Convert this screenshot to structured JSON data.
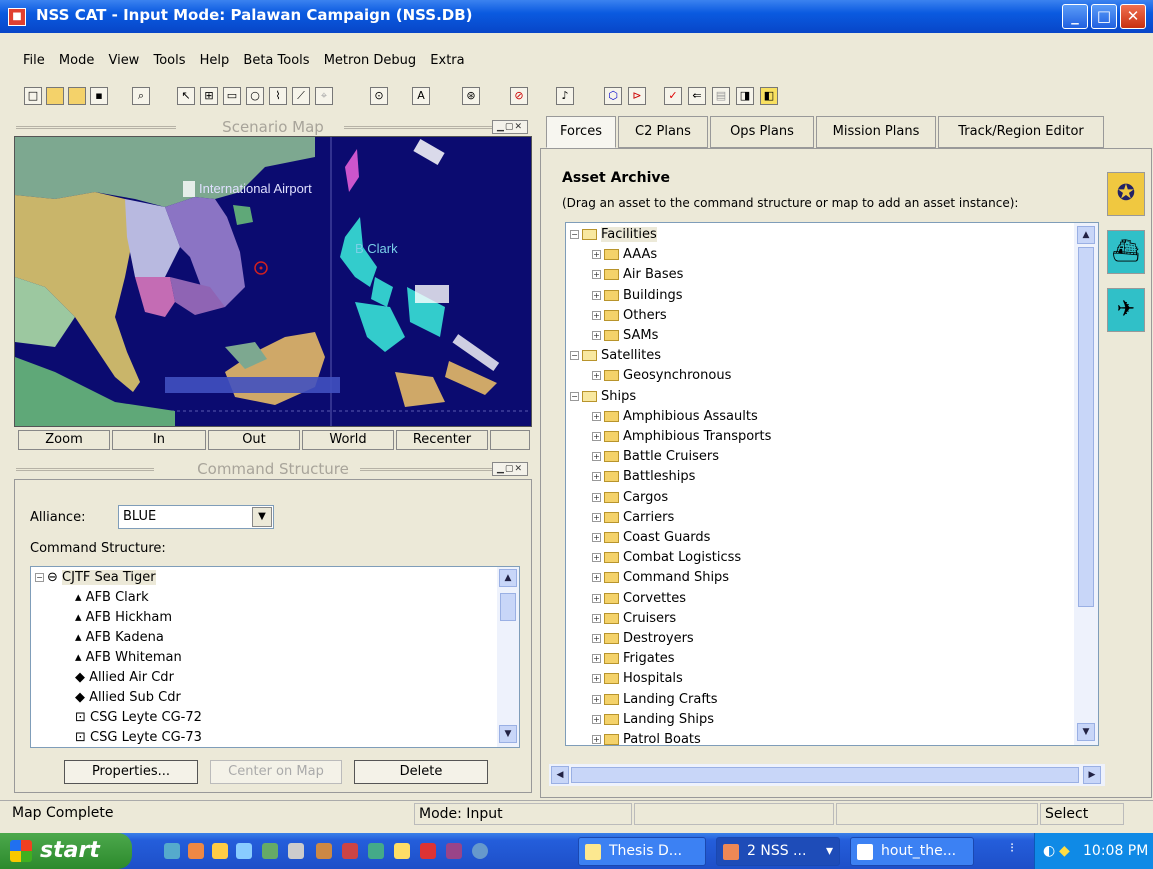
{
  "window": {
    "title": "NSS CAT - Input Mode: Palawan Campaign (NSS.DB)"
  },
  "menu": [
    "File",
    "Mode",
    "View",
    "Tools",
    "Help",
    "Beta Tools",
    "Metron Debug",
    "Extra"
  ],
  "scenario_map": {
    "title": "Scenario Map",
    "labels": {
      "airport": "International Airport",
      "clark": "B Clark"
    },
    "buttons": [
      "Zoom",
      "In",
      "Out",
      "World",
      "Recenter"
    ]
  },
  "command_structure": {
    "title": "Command Structure",
    "alliance_label": "Alliance:",
    "alliance_value": "BLUE",
    "tree_label": "Command Structure:",
    "items": [
      "CJTF Sea Tiger",
      "AFB Clark",
      "AFB Hickham",
      "AFB Kadena",
      "AFB Whiteman",
      "Allied Air Cdr",
      "Allied Sub Cdr",
      "CSG Leyte CG-72",
      "CSG Leyte CG-73"
    ],
    "buttons": {
      "properties": "Properties...",
      "center": "Center on Map",
      "delete": "Delete"
    }
  },
  "tabs": [
    "Forces",
    "C2 Plans",
    "Ops Plans",
    "Mission Plans",
    "Track/Region Editor"
  ],
  "asset_archive": {
    "title": "Asset Archive",
    "hint": "(Drag an asset to the command structure or map to add an asset instance):",
    "groups": [
      {
        "name": "Facilities",
        "items": [
          "AAAs",
          "Air Bases",
          "Buildings",
          "Others",
          "SAMs"
        ]
      },
      {
        "name": "Satellites",
        "items": [
          "Geosynchronous"
        ]
      },
      {
        "name": "Ships",
        "items": [
          "Amphibious Assaults",
          "Amphibious Transports",
          "Battle Cruisers",
          "Battleships",
          "Cargos",
          "Carriers",
          "Coast Guards",
          "Combat Logisticss",
          "Command Ships",
          "Corvettes",
          "Cruisers",
          "Destroyers",
          "Frigates",
          "Hospitals",
          "Landing Crafts",
          "Landing Ships",
          "Patrol Boats"
        ]
      }
    ]
  },
  "status": {
    "left": "Map Complete",
    "mode": "Mode: Input",
    "right": "Select"
  },
  "taskbar": {
    "start": "start",
    "tasks": [
      "Thesis D...",
      "2 NSS ...",
      "hout_the..."
    ],
    "clock": "10:08 PM"
  },
  "colors": {
    "map_water": "#0b0b70",
    "titlebar": "#0a5ae0",
    "start_green": "#2c8a2c"
  }
}
